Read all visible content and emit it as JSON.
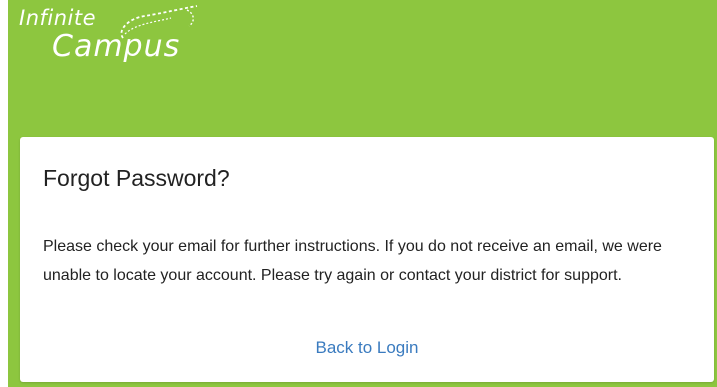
{
  "brand": {
    "logo_line1": "Infinite",
    "logo_line2": "Campus",
    "background_color": "#8dc63f"
  },
  "card": {
    "title": "Forgot Password?",
    "message": "Please check your email for further instructions. If you do not receive an email, we were unable to locate your account. Please try again or contact your district for support.",
    "back_link_label": "Back to Login",
    "link_color": "#3a7bbf"
  }
}
